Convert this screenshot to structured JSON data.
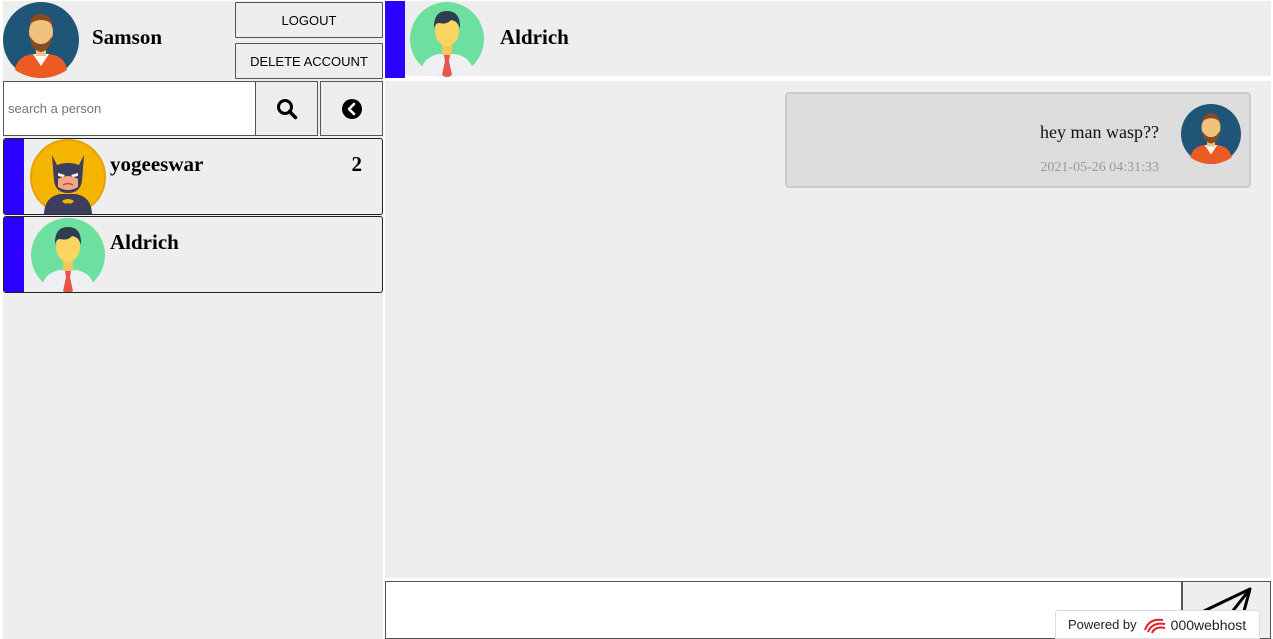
{
  "user": {
    "name": "Samson"
  },
  "header_buttons": {
    "logout": "LOGOUT",
    "delete_account": "DELETE ACCOUNT"
  },
  "search": {
    "placeholder": "search a person",
    "value": ""
  },
  "contacts": [
    {
      "name": "yogeeswar",
      "unread": "2",
      "avatar": "batman-avatar"
    },
    {
      "name": "Aldrich",
      "unread": "",
      "avatar": "man-green-avatar"
    }
  ],
  "chat": {
    "partner": "Aldrich",
    "messages": [
      {
        "text": "hey man wasp??",
        "time": "2021-05-26 04:31:33",
        "avatar": "bearded-man-avatar"
      }
    ]
  },
  "composer": {
    "value": ""
  },
  "footer": {
    "powered_by": "Powered by",
    "brand": "000webhost"
  },
  "colors": {
    "accent": "#2b00ff",
    "panel": "#eeeeee",
    "message_bg": "#dddddd"
  }
}
